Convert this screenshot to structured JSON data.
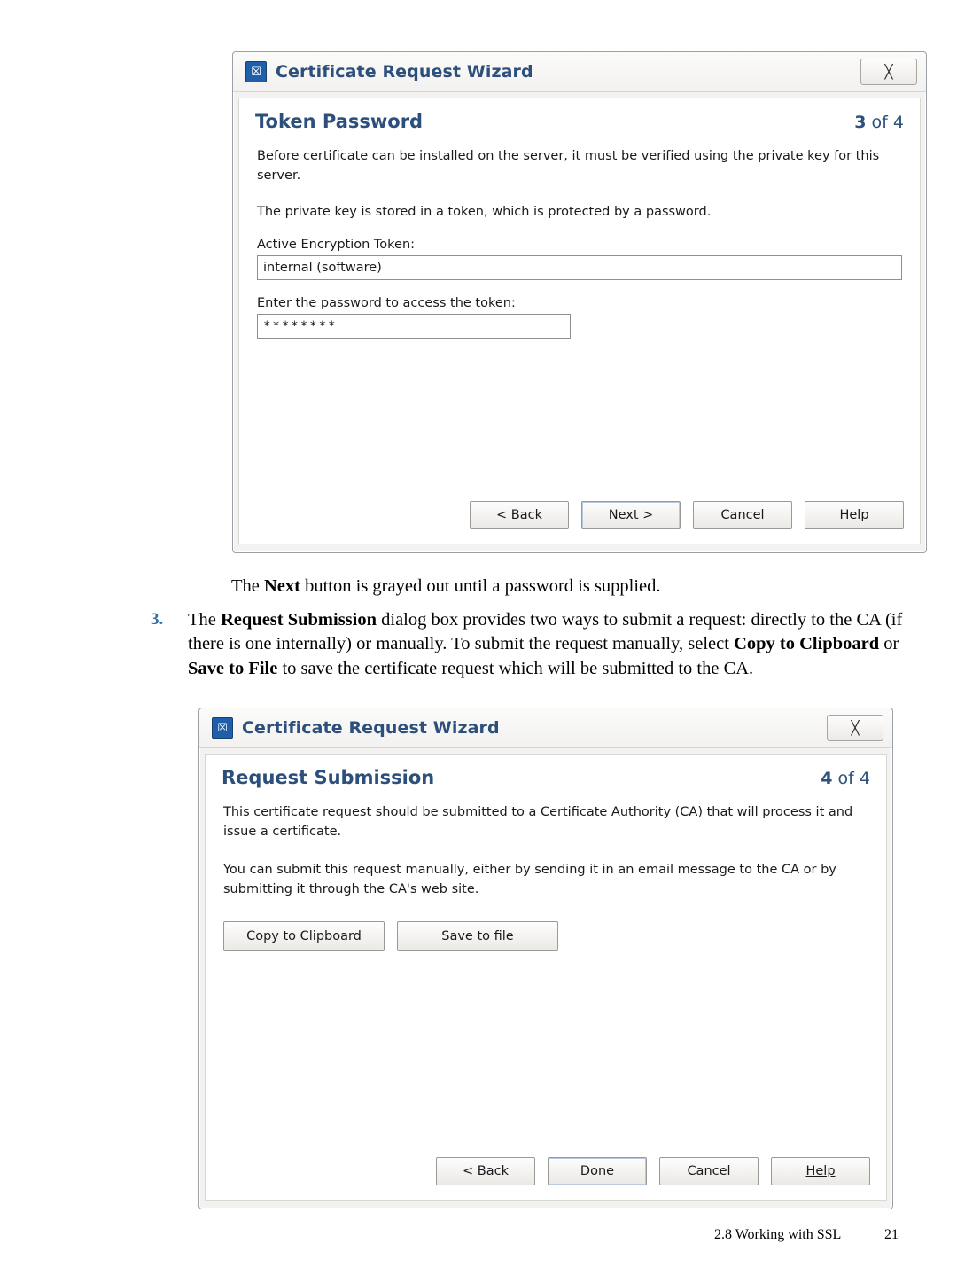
{
  "dialog1": {
    "icon": "certificate-wizard-icon",
    "icon_glyph": "☒",
    "title": "Certificate Request Wizard",
    "close_glyph": "╳",
    "heading": "Token Password",
    "step_current": "3",
    "step_of": " of 4",
    "para1": "Before certificate can be installed on the server, it must be verified using the private key for this server.",
    "para2": "The private key is stored in a token, which is protected by a password.",
    "label_token": "Active Encryption Token:",
    "value_token": "internal (software)",
    "label_password": "Enter the password to access the token:",
    "value_password": "********",
    "buttons": {
      "back": "< Back",
      "next": "Next >",
      "cancel": "Cancel",
      "help": "Help"
    }
  },
  "note": {
    "text_before": "The ",
    "bold": "Next",
    "text_after": " button is grayed out until a password is supplied."
  },
  "step3": {
    "number": "3.",
    "line1_a": "The ",
    "line1_b": "Request Submission",
    "line1_c": " dialog box provides two ways to submit a request: directly to",
    "line2_a": "the CA (if there is one internally) or manually. To submit the request manually, select ",
    "line2_b": "Copy",
    "line3_a": "to Clipboard",
    "line3_b": " or ",
    "line3_c": "Save to File",
    "line3_d": " to save the certificate request which will be submitted to the",
    "line4": "CA."
  },
  "dialog2": {
    "icon": "certificate-wizard-icon",
    "icon_glyph": "☒",
    "title": "Certificate Request Wizard",
    "close_glyph": "╳",
    "heading": "Request Submission",
    "step_current": "4",
    "step_of": " of 4",
    "para1": "This certificate request should be submitted to a Certificate Authority (CA) that will process it and issue a certificate.",
    "para2": "You can submit this request manually, either by sending it in an email message to the CA or by submitting it through the CA's web site.",
    "action_buttons": {
      "copy": "Copy to Clipboard",
      "save": "Save to file"
    },
    "buttons": {
      "back": "< Back",
      "done": "Done",
      "cancel": "Cancel",
      "help": "Help"
    }
  },
  "footer": {
    "section": "2.8 Working with SSL",
    "page": "21"
  }
}
